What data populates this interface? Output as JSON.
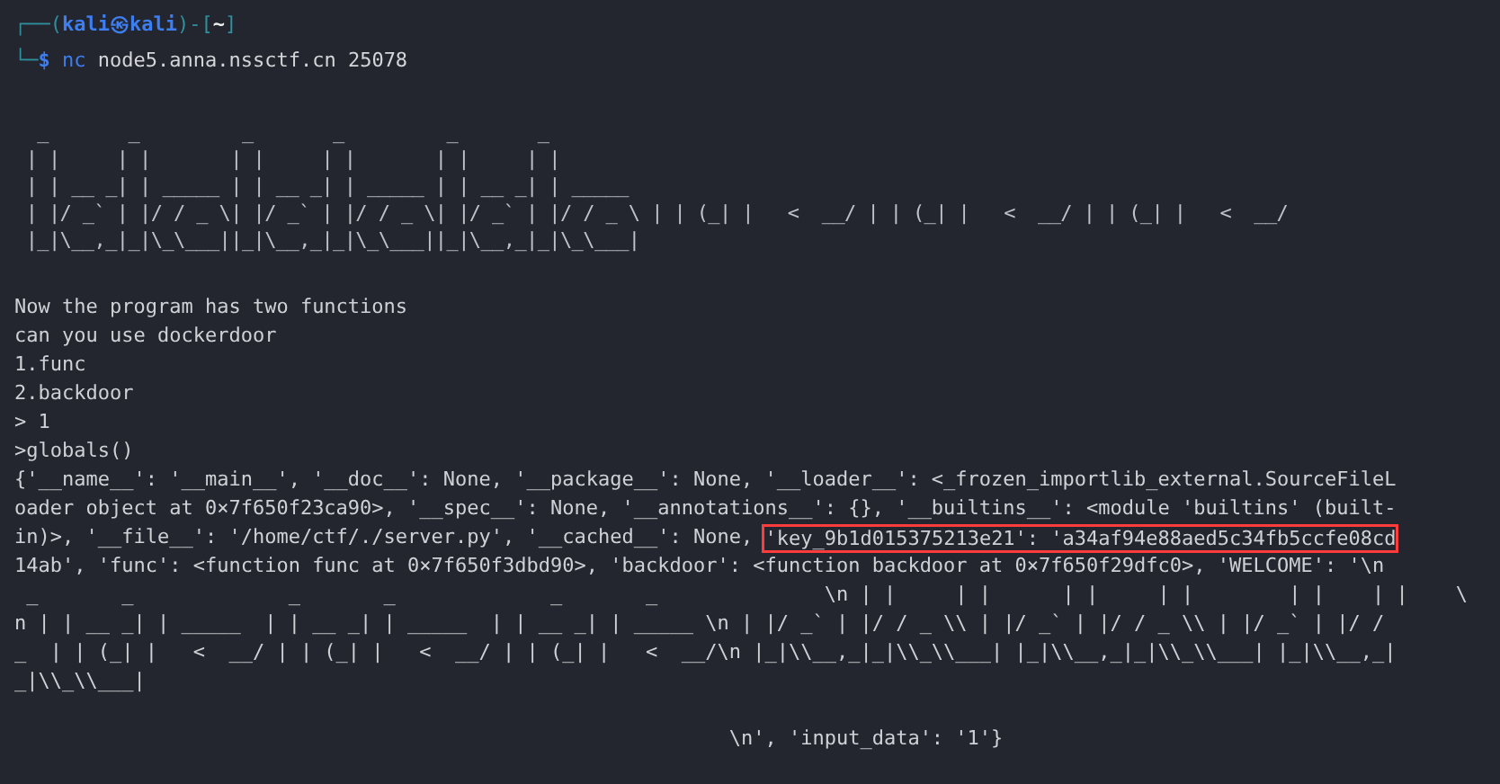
{
  "prompt": [
    [
      {
        "kind": "frame",
        "text": "┌──("
      },
      {
        "kind": "user",
        "text": "kali㉿kali"
      },
      {
        "kind": "frame",
        "text": ")-["
      },
      {
        "kind": "path",
        "text": "~"
      },
      {
        "kind": "frame",
        "text": "]"
      }
    ],
    [
      {
        "kind": "frame",
        "text": "└─"
      },
      {
        "kind": "symbol",
        "text": "$"
      },
      {
        "kind": "command",
        "text": " nc"
      },
      {
        "kind": "arg",
        "text": " node5.anna.nssctf.cn 25078"
      }
    ]
  ],
  "banner": [
    "  _       _         _       _         _       _",
    " | |     | |       | |     | |       | |     | |",
    " | | __ _| | _____ | | __ _| | _____ | | __ _| | _____",
    " | |/ _` | |/ / _ \\| |/ _` | |/ / _ \\| |/ _` | |/ / _ \\ | | (_| |   <  __/ | | (_| |   <  __/ | | (_| |   <  __/",
    " |_|\\__,_|_|\\_\\___||_|\\__,_|_|\\_\\___||_|\\__,_|_|\\_\\___|"
  ],
  "output": [
    {
      "text": "Now the program has two functions"
    },
    {
      "text": "can you use dockerdoor"
    },
    {
      "text": "1.func"
    },
    {
      "text": "2.backdoor"
    },
    {
      "text": "> 1"
    },
    {
      "text": ">globals()"
    },
    {
      "text": "{'__name__': '__main__', '__doc__': None, '__package__': None, '__loader__': <_frozen_importlib_external.SourceFileL"
    },
    {
      "text": "oader object at 0×7f650f23ca90>, '__spec__': None, '__annotations__': {}, '__builtins__': <module 'builtins' (built-"
    },
    {
      "text": "in)>, '__file__': '/home/ctf/./server.py', '__cached__': None, ",
      "highlight": "'key_9b1d015375213e21': 'a34af94e88aed5c34fb5ccfe08cd"
    },
    {
      "text": "14ab', 'func': <function func at 0×7f650f3dbd90>, 'backdoor': <function backdoor at 0×7f650f29dfc0>, 'WELCOME': '\\n"
    },
    {
      "text": " _       _             _       _             _       _              \\n | |     | |      | |     | |        | |    | |    \\"
    },
    {
      "text": "n | | __ _| | _____  | | __ _| | _____  | | __ _| | _____ \\n | |/ _` | |/ / _ \\\\ | |/ _` | |/ / _ \\\\ | |/ _` | |/ /"
    },
    {
      "text": "_  | | (_| |   <  __/ | | (_| |   <  __/ | | (_| |   <  __/\\n |_|\\\\__,_|_|\\\\_\\\\___| |_|\\\\__,_|_|\\\\_\\\\___| |_|\\\\__,_|"
    },
    {
      "text": "_|\\\\_\\\\___|"
    },
    {
      "text": "                                                            \\n', 'input_data': '1'}"
    }
  ]
}
